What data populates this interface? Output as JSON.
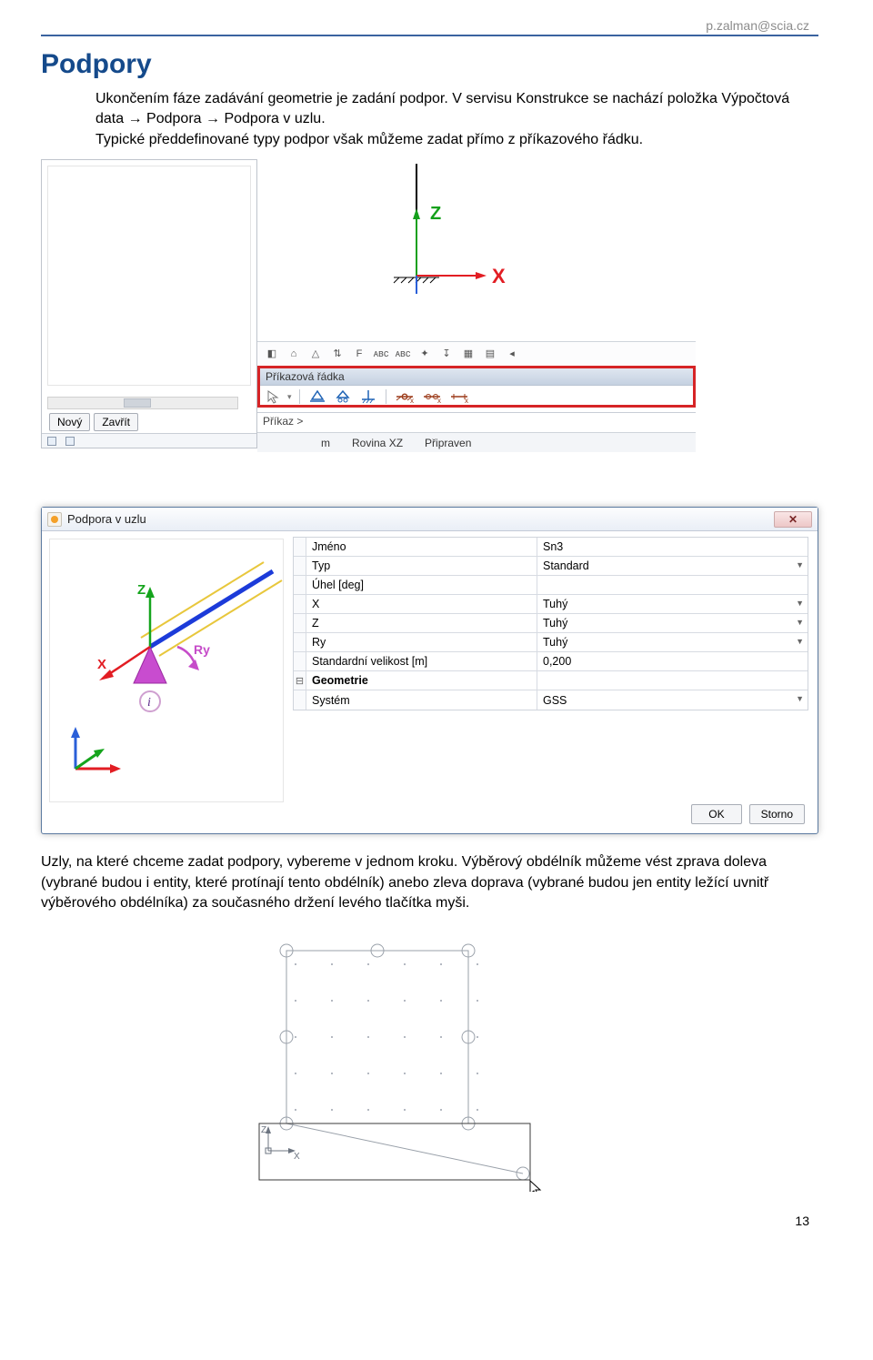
{
  "header_email": "p.zalman@scia.cz",
  "heading": "Podpory",
  "para1a": "Ukončením fáze zadávání geometrie je zadání podpor. V servisu Konstrukce se nachází položka Výpočtová data",
  "para1b": "Podpora",
  "para1c": "Podpora v uzlu.",
  "para1_line2": "Typické předdefinované typy podpor však můžeme zadat přímo z příkazového řádku.",
  "side_btn_new": "Nový",
  "side_btn_close": "Zavřít",
  "axis_z": "Z",
  "axis_x": "X",
  "cmdline_title": "Příkazová řádka",
  "cmdline_prompt": "Příkaz >",
  "status_unit": "m",
  "status_plane": "Rovina XZ",
  "status_ready": "Připraven",
  "dialog_title": "Podpora v uzlu",
  "props": {
    "name_k": "Jméno",
    "name_v": "Sn3",
    "type_k": "Typ",
    "type_v": "Standard",
    "angle_k": "Úhel [deg]",
    "angle_v": "",
    "x_k": "X",
    "x_v": "Tuhý",
    "z_k": "Z",
    "z_v": "Tuhý",
    "ry_k": "Ry",
    "ry_v": "Tuhý",
    "stdsize_k": "Standardní velikost [m]",
    "stdsize_v": "0,200",
    "geom_k": "Geometrie",
    "sys_k": "Systém",
    "sys_v": "GSS"
  },
  "btn_ok": "OK",
  "btn_cancel": "Storno",
  "axis_ry": "Ry",
  "para2": "Uzly, na které chceme zadat podpory, vybereme v jednom kroku. Výběrový obdélník můžeme vést zprava doleva (vybrané budou i entity, které protínají tento obdélník) anebo zleva doprava (vybrané budou jen entity ležící uvnitř výběrového obdélníka) za současného držení levého tlačítka myši.",
  "page_number": "13"
}
